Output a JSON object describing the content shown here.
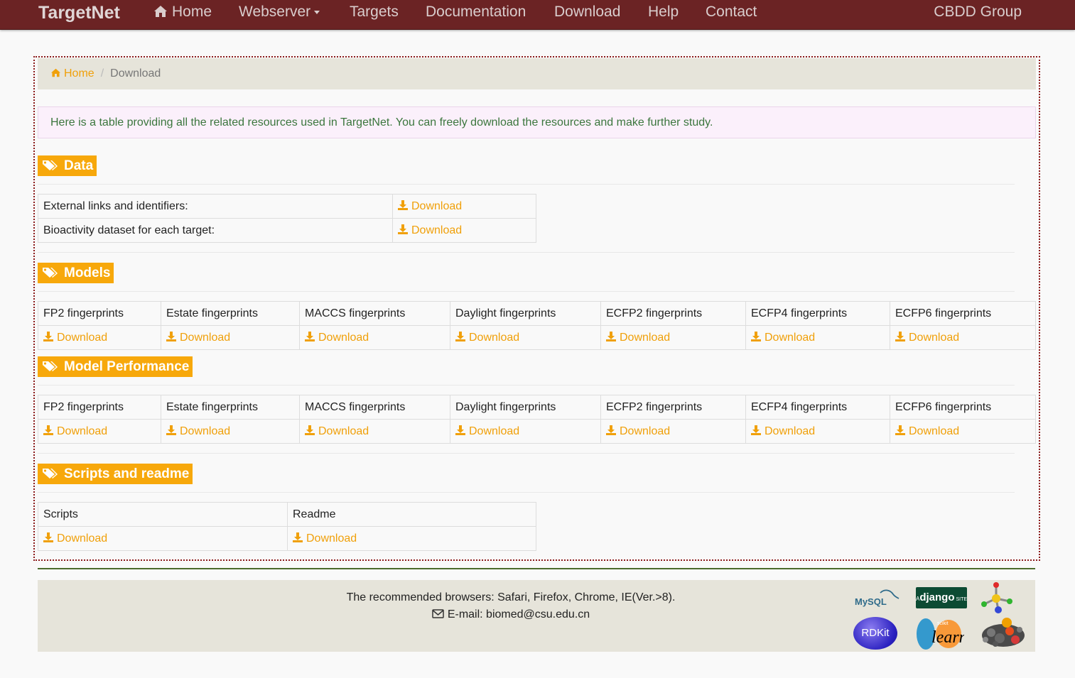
{
  "navbar": {
    "brand": "TargetNet",
    "items": [
      "Home",
      "Webserver",
      "Targets",
      "Documentation",
      "Download",
      "Help",
      "Contact"
    ],
    "right": "CBDD Group"
  },
  "breadcrumb": {
    "home": "Home",
    "current": "Download"
  },
  "info": "Here is a table providing all the related resources used in TargetNet. You can freely download the resources and make further study.",
  "download_label": "Download",
  "sections": {
    "data": {
      "title": "Data",
      "rows": [
        "External links and identifiers:",
        "Bioactivity dataset for each target:"
      ]
    },
    "models": {
      "title": "Models",
      "headers": [
        "FP2 fingerprints",
        "Estate fingerprints",
        "MACCS fingerprints",
        "Daylight fingerprints",
        "ECFP2 fingerprints",
        "ECFP4 fingerprints",
        "ECFP6 fingerprints"
      ]
    },
    "performance": {
      "title": "Model Performance",
      "headers": [
        "FP2 fingerprints",
        "Estate fingerprints",
        "MACCS fingerprints",
        "Daylight fingerprints",
        "ECFP2 fingerprints",
        "ECFP4 fingerprints",
        "ECFP6 fingerprints"
      ]
    },
    "scripts": {
      "title": "Scripts and readme",
      "headers": [
        "Scripts",
        "Readme"
      ]
    }
  },
  "footer": {
    "browsers": "The recommended browsers: Safari, Firefox, Chrome, IE(Ver.>8).",
    "email": "E-mail: biomed@csu.edu.cn",
    "logos": {
      "mysql": "MySQL",
      "django": "django",
      "django_prefix": "A",
      "django_suffix": "SITE",
      "rdkit": "RDKit",
      "sklearn": "learn",
      "sklearn_prefix": "scikit"
    }
  },
  "colors": {
    "navbar": "#6b2324",
    "accent": "#f7a80b",
    "link": "#f0a00a",
    "info_text": "#3b763d"
  }
}
